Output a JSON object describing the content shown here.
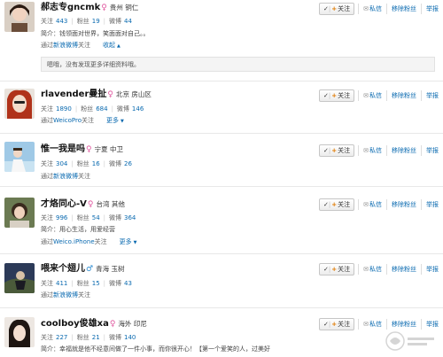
{
  "labels": {
    "follows": "关注",
    "fans": "粉丝",
    "posts": "微博",
    "via": "通过",
    "follow_btn": "关注",
    "message": "私信",
    "remove_fan": "移除粉丝",
    "report": "举报",
    "more": "更多",
    "collapse": "收起",
    "intro_prefix": "简介："
  },
  "icons": {
    "check": "check-icon",
    "plus": "plus-icon",
    "message": "envelope-icon",
    "remove": "remove-icon",
    "report": "flag-icon"
  },
  "colors": {
    "link": "#0a6ab0",
    "female": "#e05aa0",
    "male": "#2a8ad0",
    "plus": "#e07a00"
  },
  "fans": [
    {
      "name": "郝志专gncmk",
      "gender": "♀",
      "location": "贵州 铜仁",
      "follows": "443",
      "fans": "19",
      "posts": "44",
      "intro": "简介：钱领面对世界，笑面面对自己。。",
      "via": "新浪微博",
      "via_suffix": "关注",
      "expand_text": "嗯哦，没有发现更多详细资料哦。"
    },
    {
      "name": "rlavender曼扯",
      "gender": "♀",
      "location": "北京 房山区",
      "follows": "1890",
      "fans": "684",
      "posts": "146",
      "via": "WeicoPro",
      "via_suffix": "关注"
    },
    {
      "name": "惟一我是吗",
      "gender": "♀",
      "location": "宁夏 中卫",
      "follows": "304",
      "fans": "16",
      "posts": "26",
      "via": "新浪微博",
      "via_suffix": "关注"
    },
    {
      "name": "才烙同心-V",
      "gender": "♀",
      "location": "台湾 其他",
      "follows": "996",
      "fans": "54",
      "posts": "364",
      "intro": "简介：用心生活，用爱经营",
      "via": "Weico.iPhone",
      "via_suffix": "关注"
    },
    {
      "name": "喂来个翅儿",
      "gender": "♂",
      "location": "青海 玉树",
      "follows": "411",
      "fans": "15",
      "posts": "43",
      "via": "新浪微博",
      "via_suffix": "关注"
    },
    {
      "name": "coolboy俊雄xa",
      "gender": "♀",
      "location": "海外 印尼",
      "follows": "227",
      "fans": "21",
      "posts": "140",
      "intro": "简介：幸福就是他不经意间做了一件小事，而你很开心！【第一个爱笑的人，过美好"
    }
  ]
}
